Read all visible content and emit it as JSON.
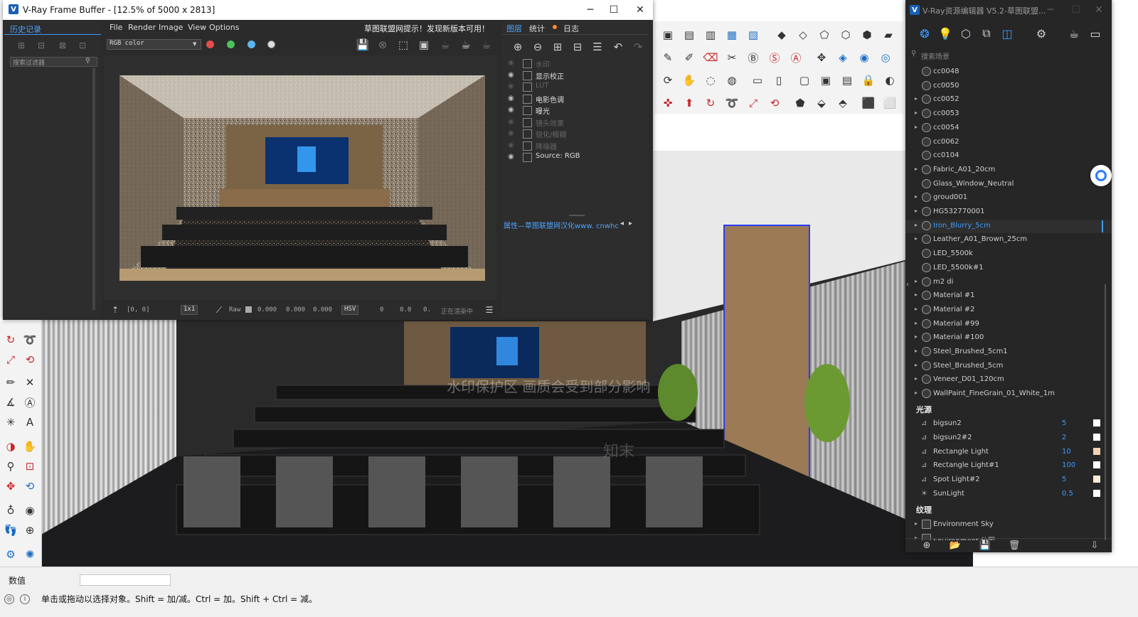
{
  "vfb": {
    "title": "V-Ray Frame Buffer - [12.5% of 5000 x 2813]",
    "history_tab": "历史记录",
    "history_filter_placeholder": "搜索过滤器",
    "menu": [
      "File",
      "Render",
      "Image",
      "View",
      "Options"
    ],
    "update_notice": "草图联盟网提示！发现新版本可用！",
    "channel": "RGB color",
    "layer_tabs": [
      "图层",
      "统计",
      "日志"
    ],
    "layers": [
      {
        "name": "水印",
        "enabled": false
      },
      {
        "name": "显示校正",
        "enabled": true
      },
      {
        "name": "LUT",
        "enabled": false
      },
      {
        "name": "电影色调",
        "enabled": true
      },
      {
        "name": "曝光",
        "enabled": true
      },
      {
        "name": "镜头效果",
        "enabled": false
      },
      {
        "name": "锐化/模糊",
        "enabled": false
      },
      {
        "name": "降噪器",
        "enabled": false
      },
      {
        "name": "Source: RGB",
        "enabled": true
      }
    ],
    "properties_label": "属性—草图联盟网汉化www. cnwhc",
    "bottom": {
      "coords": "[0, 0]",
      "zoom": "1x1",
      "raw_label": "Raw",
      "raw_values": [
        "0.000",
        "0.000",
        "0.000"
      ],
      "color_mode": "HSV",
      "hsv_values": [
        "0",
        "0.0",
        "0."
      ],
      "status": "正在渲染中"
    }
  },
  "asset_editor": {
    "title": "V-Ray资源编辑器 V5.2-草图联盟...",
    "search_placeholder": "搜索场景",
    "materials": [
      {
        "name": "cc0048",
        "caret": false
      },
      {
        "name": "cc0050",
        "caret": false
      },
      {
        "name": "cc0052",
        "caret": true
      },
      {
        "name": "cc0053",
        "caret": true
      },
      {
        "name": "cc0054",
        "caret": true
      },
      {
        "name": "cc0062",
        "caret": false
      },
      {
        "name": "cc0104",
        "caret": false
      },
      {
        "name": "Fabric_A01_20cm",
        "caret": true
      },
      {
        "name": "Glass_Window_Neutral",
        "caret": false
      },
      {
        "name": "groud001",
        "caret": true
      },
      {
        "name": "HG532770001",
        "caret": true
      },
      {
        "name": "Iron_Blurry_5cm",
        "caret": true,
        "selected": true
      },
      {
        "name": "Leather_A01_Brown_25cm",
        "caret": true
      },
      {
        "name": "LED_5500k",
        "caret": false
      },
      {
        "name": "LED_5500k#1",
        "caret": false
      },
      {
        "name": "m2 di",
        "caret": true
      },
      {
        "name": "Material #1",
        "caret": true
      },
      {
        "name": "Material #2",
        "caret": true
      },
      {
        "name": "Material #99",
        "caret": true
      },
      {
        "name": "Material #100",
        "caret": true
      },
      {
        "name": "Steel_Brushed_5cm1",
        "caret": true
      },
      {
        "name": "Steel_Brushed_5cm",
        "caret": true
      },
      {
        "name": "Veneer_D01_120cm",
        "caret": true
      },
      {
        "name": "WallPaint_FineGrain_01_White_1m",
        "caret": true
      }
    ],
    "lights_title": "光源",
    "lights": [
      {
        "name": "bigsun2",
        "value": "5",
        "swatch": "#ffffff"
      },
      {
        "name": "bigsun2#2",
        "value": "2",
        "swatch": "#ffffff"
      },
      {
        "name": "Rectangle Light",
        "value": "10",
        "swatch": "#f2d2b0"
      },
      {
        "name": "Rectangle Light#1",
        "value": "100",
        "swatch": "#ffffff"
      },
      {
        "name": "Spot Light#2",
        "value": "5",
        "swatch": "#f7ecd8"
      },
      {
        "name": "SunLight",
        "value": "0.5",
        "swatch": "#ffffff"
      }
    ],
    "textures_title": "纹理",
    "textures": [
      "Environment Sky",
      "Environment 位图"
    ]
  },
  "sketchup": {
    "value_label": "数值",
    "status_text": "单击或拖动以选择对象。Shift = 加/减。Ctrl = 加。Shift + Ctrl = 减。",
    "watermark": "水印保护区  画质会受到部分影响",
    "watermark_small": "知末"
  },
  "colors": {
    "accent": "#3d9bff",
    "vfb_bg": "#2b2b2b",
    "editor_bg": "#262626"
  }
}
